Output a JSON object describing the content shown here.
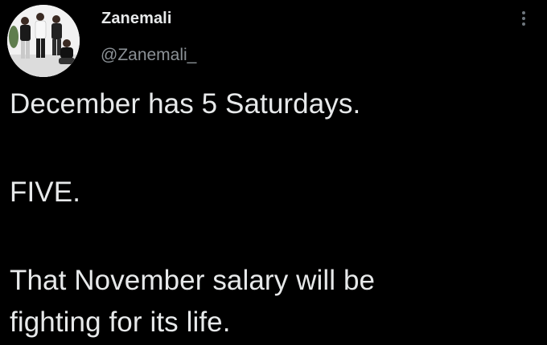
{
  "tweet": {
    "author_name": "Zanemali",
    "author_handle": "@Zanemali_",
    "avatar_icon": "profile-photo-icon",
    "more_icon": "more-options-icon",
    "lines": [
      "December has 5 Saturdays.",
      "FIVE.",
      "That November salary will be",
      "fighting for its life."
    ]
  },
  "colors": {
    "background": "#000000",
    "text_primary": "#e7e9ea",
    "text_secondary": "#8b9196",
    "icon_muted": "#6e767d"
  }
}
